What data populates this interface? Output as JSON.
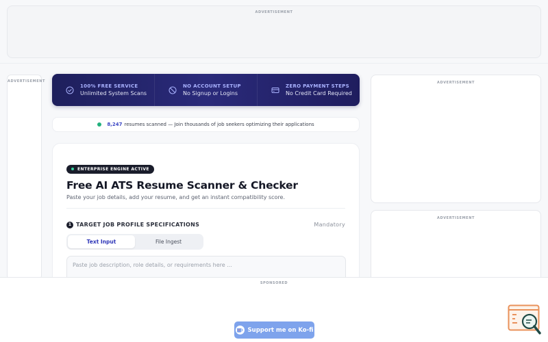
{
  "ads": {
    "top_label": "ADVERTISEMENT",
    "left_label": "ADVERTISEMENT",
    "right1_label": "ADVERTISEMENT",
    "right2_label": "ADVERTISEMENT",
    "bottom_label": "SPONSORED"
  },
  "features": [
    {
      "title": "100% FREE SERVICE",
      "subtitle": "Unlimited System Scans",
      "icon": "check-circle-icon"
    },
    {
      "title": "NO ACCOUNT SETUP",
      "subtitle": "No Signup or Logins",
      "icon": "no-entry-icon"
    },
    {
      "title": "ZERO PAYMENT STEPS",
      "subtitle": "No Credit Card Required",
      "icon": "credit-card-icon"
    }
  ],
  "stats": {
    "count": "8,247",
    "text": "resumes scanned — Join thousands of job seekers optimizing their applications"
  },
  "main": {
    "badge": "ENTERPRISE ENGINE ACTIVE",
    "title": "Free AI ATS Resume Scanner & Checker",
    "subtitle": "Paste your job details, add your resume, and get an instant compatibility score.",
    "section": {
      "step": "1",
      "title": "TARGET JOB PROFILE SPECIFICATIONS",
      "mandatory": "Mandatory"
    },
    "tabs": [
      {
        "label": "Text Input",
        "active": true
      },
      {
        "label": "File Ingest",
        "active": false
      }
    ],
    "textarea_placeholder": "Paste job description, role details, or requirements here ..."
  },
  "kofi": {
    "label": "Support me on Ko-fi"
  },
  "colors": {
    "feature_bar": "#1e1f5c",
    "accent": "#3b46c4",
    "status_dot": "#22b07d",
    "kofi": "#7ea3ec"
  }
}
